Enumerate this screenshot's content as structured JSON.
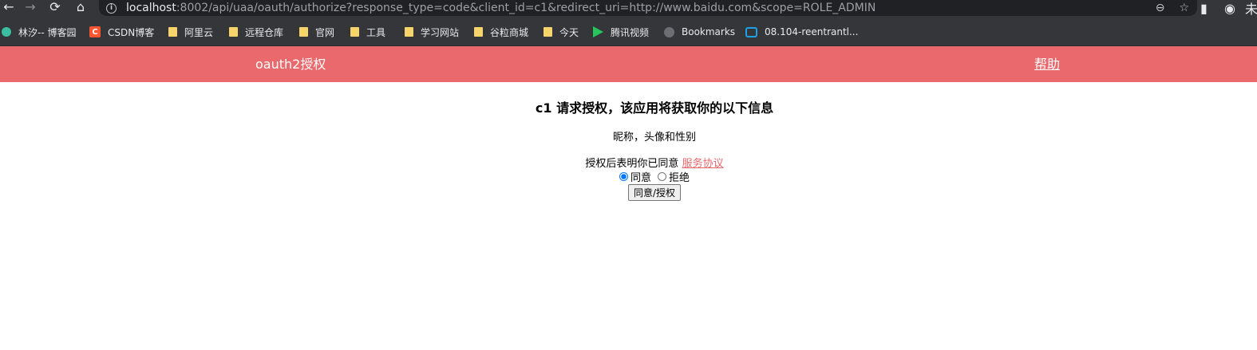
{
  "browser": {
    "url_host": "localhost",
    "url_rest": ":8002/api/uaa/oauth/authorize?response_type=code&client_id=c1&redirect_uri=http://www.baidu.com&scope=ROLE_ADMIN",
    "bookmarks": [
      {
        "label": "林汐-- 博客园",
        "icon": "cnblogs-icon"
      },
      {
        "label": "CSDN博客",
        "icon": "csdn-icon"
      },
      {
        "label": "阿里云",
        "icon": "folder-icon"
      },
      {
        "label": "远程仓库",
        "icon": "folder-icon"
      },
      {
        "label": "官网",
        "icon": "folder-icon"
      },
      {
        "label": "工具",
        "icon": "folder-icon"
      },
      {
        "label": "学习网站",
        "icon": "folder-icon"
      },
      {
        "label": "谷粒商城",
        "icon": "folder-icon"
      },
      {
        "label": "今天",
        "icon": "folder-icon"
      },
      {
        "label": "腾讯视频",
        "icon": "video-icon"
      },
      {
        "label": "Bookmarks",
        "icon": "globe-icon"
      },
      {
        "label": "08.104-reentrantl...",
        "icon": "bilibili-icon"
      }
    ]
  },
  "header": {
    "brand": "oauth2授权",
    "help": "帮助"
  },
  "main": {
    "title": "c1 请求授权，该应用将获取你的以下信息",
    "info": "昵称，头像和性别",
    "agree_prefix": "授权后表明你已同意 ",
    "agree_link": "服务协议",
    "option_yes": "同意",
    "option_no": "拒绝",
    "submit": "同意/授权"
  },
  "colors": {
    "header_bg": "#e9696c",
    "chrome_bg": "#35363a"
  }
}
